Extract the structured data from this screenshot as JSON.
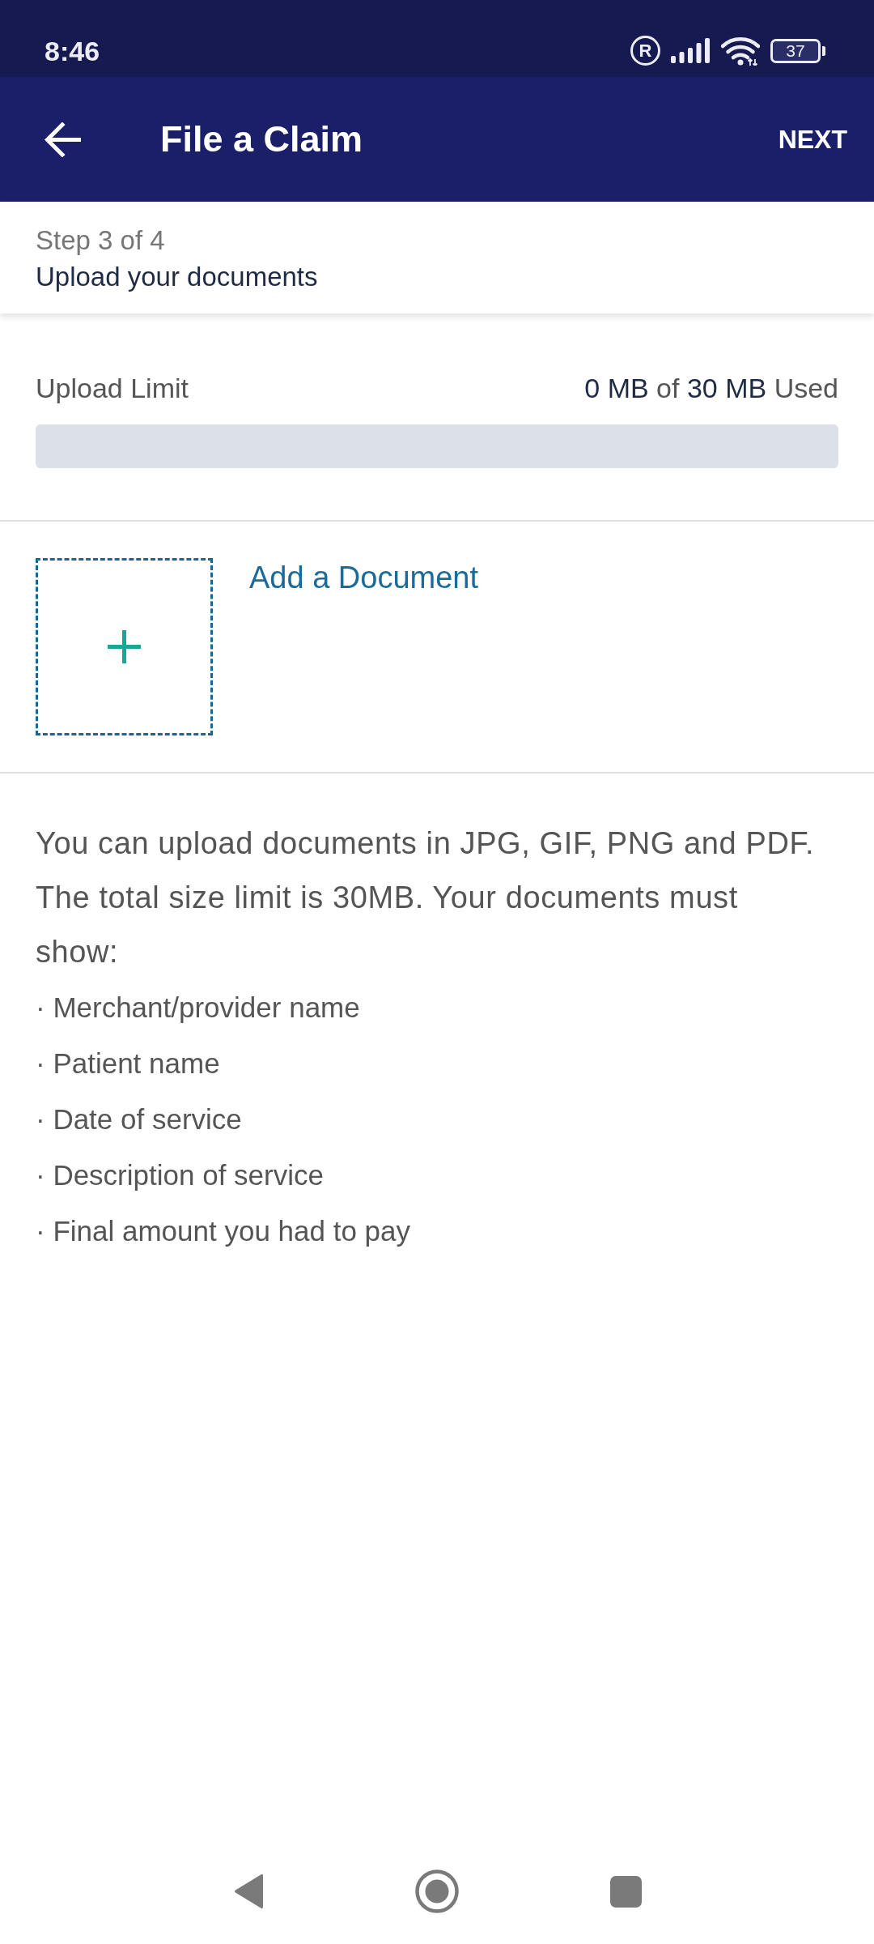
{
  "status_bar": {
    "time": "8:46",
    "roaming": "R",
    "battery": "37"
  },
  "app_bar": {
    "title": "File a Claim",
    "action": "NEXT"
  },
  "step": {
    "progress": "Step 3 of 4",
    "title": "Upload your documents"
  },
  "upload_limit": {
    "label": "Upload Limit",
    "used": "0 MB",
    "of": "of",
    "total": "30 MB",
    "suffix": "Used",
    "level": 0
  },
  "add_document": {
    "label": "Add a Document"
  },
  "instructions": {
    "text": "You can upload documents in JPG, GIF, PNG and PDF. The total size limit is 30MB. Your documents must show:",
    "items": [
      "· Merchant/provider name",
      "· Patient name",
      "· Date of service",
      "· Description of service",
      "· Final amount you had to pay"
    ]
  }
}
